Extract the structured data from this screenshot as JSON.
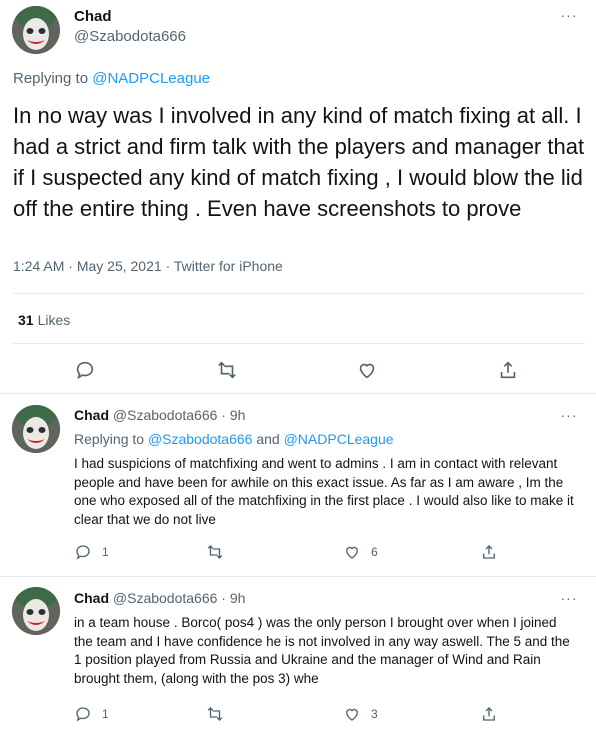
{
  "main_tweet": {
    "author_name": "Chad",
    "author_handle": "@Szabodota666",
    "replying_label": "Replying to",
    "replying_to": "@NADPCLeague",
    "text": "In no way was I involved in any kind of match fixing at all.  I had a strict and firm talk with the players and manager that if I suspected any kind of match fixing , I would blow the lid off the entire thing . Even have screenshots to prove",
    "time": "1:24 AM",
    "date": "May 25, 2021",
    "source": "Twitter for iPhone",
    "likes_count": "31",
    "likes_label": "Likes",
    "more_glyph": "···"
  },
  "replies": [
    {
      "author_name": "Chad",
      "author_handle": "@Szabodota666",
      "age": "9h",
      "replying_label": "Replying to",
      "replying_to_1": "@Szabodota666",
      "replying_and": "and",
      "replying_to_2": "@NADPCLeague",
      "text": "I had suspicions of matchfixing and went to admins . I am in contact with relevant people and have been for awhile on this exact issue. As far as I am aware , Im the one who exposed all of the matchfixing in the first place . I would also like to make it clear that we do not live",
      "reply_count": "1",
      "like_count": "6",
      "more_glyph": "···"
    },
    {
      "author_name": "Chad",
      "author_handle": "@Szabodota666",
      "age": "9h",
      "text": "in a team house . Borco( pos4 ) was the only person I brought over when I joined the team and I have confidence he is not involved in any way aswell. The 5 and the 1 position played from Russia and Ukraine and the manager of Wind and Rain brought them, (along with the pos 3) whe",
      "reply_count": "1",
      "like_count": "3",
      "more_glyph": "···"
    }
  ],
  "colors": {
    "accent": "#1d9bf0",
    "secondary_text": "#536471",
    "primary_text": "#0f1419",
    "divider": "#e6ecf0"
  },
  "icons": [
    "reply-icon",
    "retweet-icon",
    "like-icon",
    "share-icon",
    "more-icon",
    "avatar-joker"
  ]
}
